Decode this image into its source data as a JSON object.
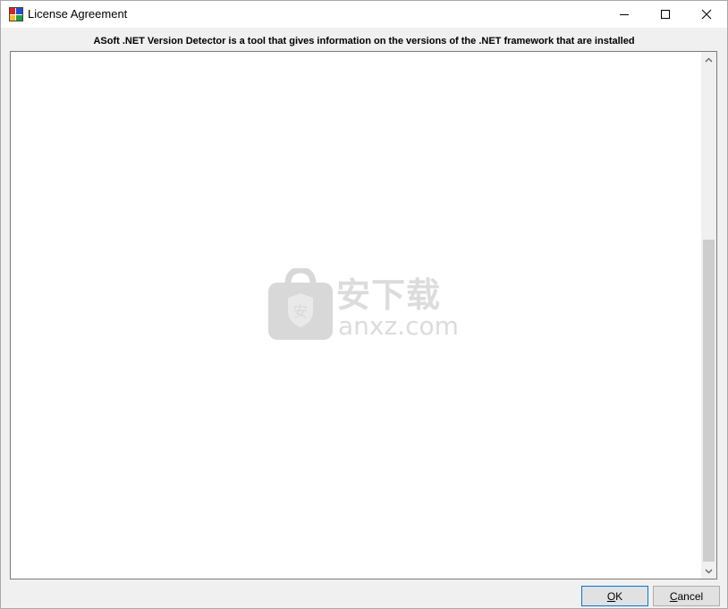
{
  "window": {
    "title": "License Agreement",
    "controls": {
      "minimize_icon": "minimize-icon",
      "maximize_icon": "maximize-icon",
      "close_icon": "close-icon"
    }
  },
  "header": {
    "description": "ASoft .NET Version Detector is a tool that gives information on the versions of the .NET framework that are installed"
  },
  "license_text": {
    "value": ""
  },
  "watermark": {
    "cn_text": "安下载",
    "en_text": "anxz.com",
    "icon": "shield-icon"
  },
  "buttons": {
    "ok_label": "OK",
    "cancel_label": "Cancel"
  },
  "colors": {
    "titlebar_bg": "#ffffff",
    "window_bg": "#f0f0f0",
    "default_button_border": "#0078d7"
  }
}
